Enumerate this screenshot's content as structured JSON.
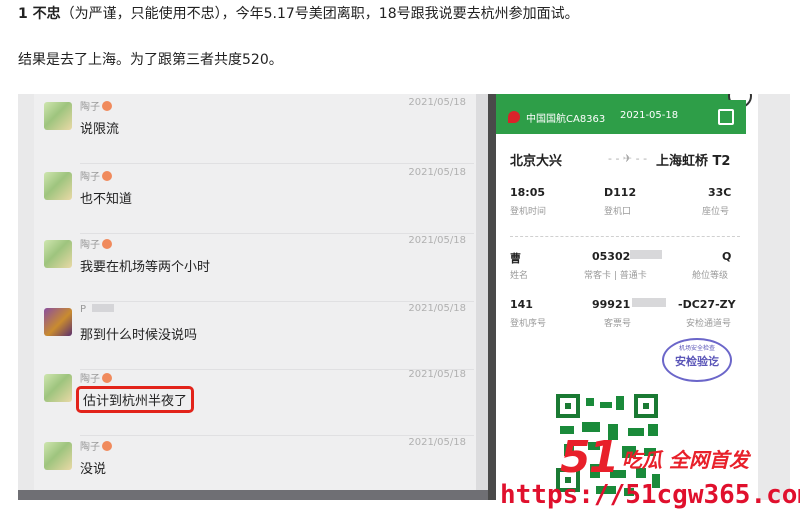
{
  "article": {
    "line1_bold": "1 不忠",
    "line1_rest": "（为严谨，只能使用不忠），今年5.17号美团离职，18号跟我说要去杭州参加面试。",
    "line2": "结果是去了上海。为了跟第三者共度520。"
  },
  "chat": {
    "messages": [
      {
        "name": "陶子",
        "date": "2021/05/18",
        "text": "说限流"
      },
      {
        "name": "陶子",
        "date": "2021/05/18",
        "text": "也不知道"
      },
      {
        "name": "陶子",
        "date": "2021/05/18",
        "text": "我要在机场等两个小时"
      },
      {
        "name": "P",
        "date": "2021/05/18",
        "text": "那到什么时候没说吗"
      },
      {
        "name": "陶子",
        "date": "2021/05/18",
        "text": "估计到杭州半夜了"
      },
      {
        "name": "陶子",
        "date": "2021/05/18",
        "text": "没说"
      }
    ]
  },
  "boarding_pass": {
    "airline_flight": "中国国航CA8363",
    "date": "2021-05-18",
    "from_city": "北京大兴",
    "to_city": "上海虹桥 T2",
    "arrow": "- - ✈ - -",
    "departure_time": "18:05",
    "departure_time_label": "登机时间",
    "gate": "D112",
    "gate_label": "登机口",
    "seat": "33C",
    "seat_label": "座位号",
    "passenger_name": "曹",
    "passenger_name_label": "姓名",
    "card_no": "05302",
    "card_label": "常客卡 | 普通卡",
    "cabin": "Q",
    "cabin_label": "舱位等级",
    "boarding_seq": "141",
    "boarding_seq_label": "登机序号",
    "ticket_no": "99921",
    "ticket_label": "客票号",
    "security_channel": "-DC27-ZY",
    "security_label": "安检通道号",
    "stamp_top": "机场安全检查",
    "stamp_main": "安检验讫",
    "colors": {
      "header_green": "#2e9e48",
      "stamp": "#6b66c9"
    }
  },
  "watermark": {
    "logo": "51",
    "name": "吃瓜 全网首发",
    "url": "https://51cgw365.com",
    "color": "#e8202a"
  },
  "highlight_color": "#e2231a"
}
